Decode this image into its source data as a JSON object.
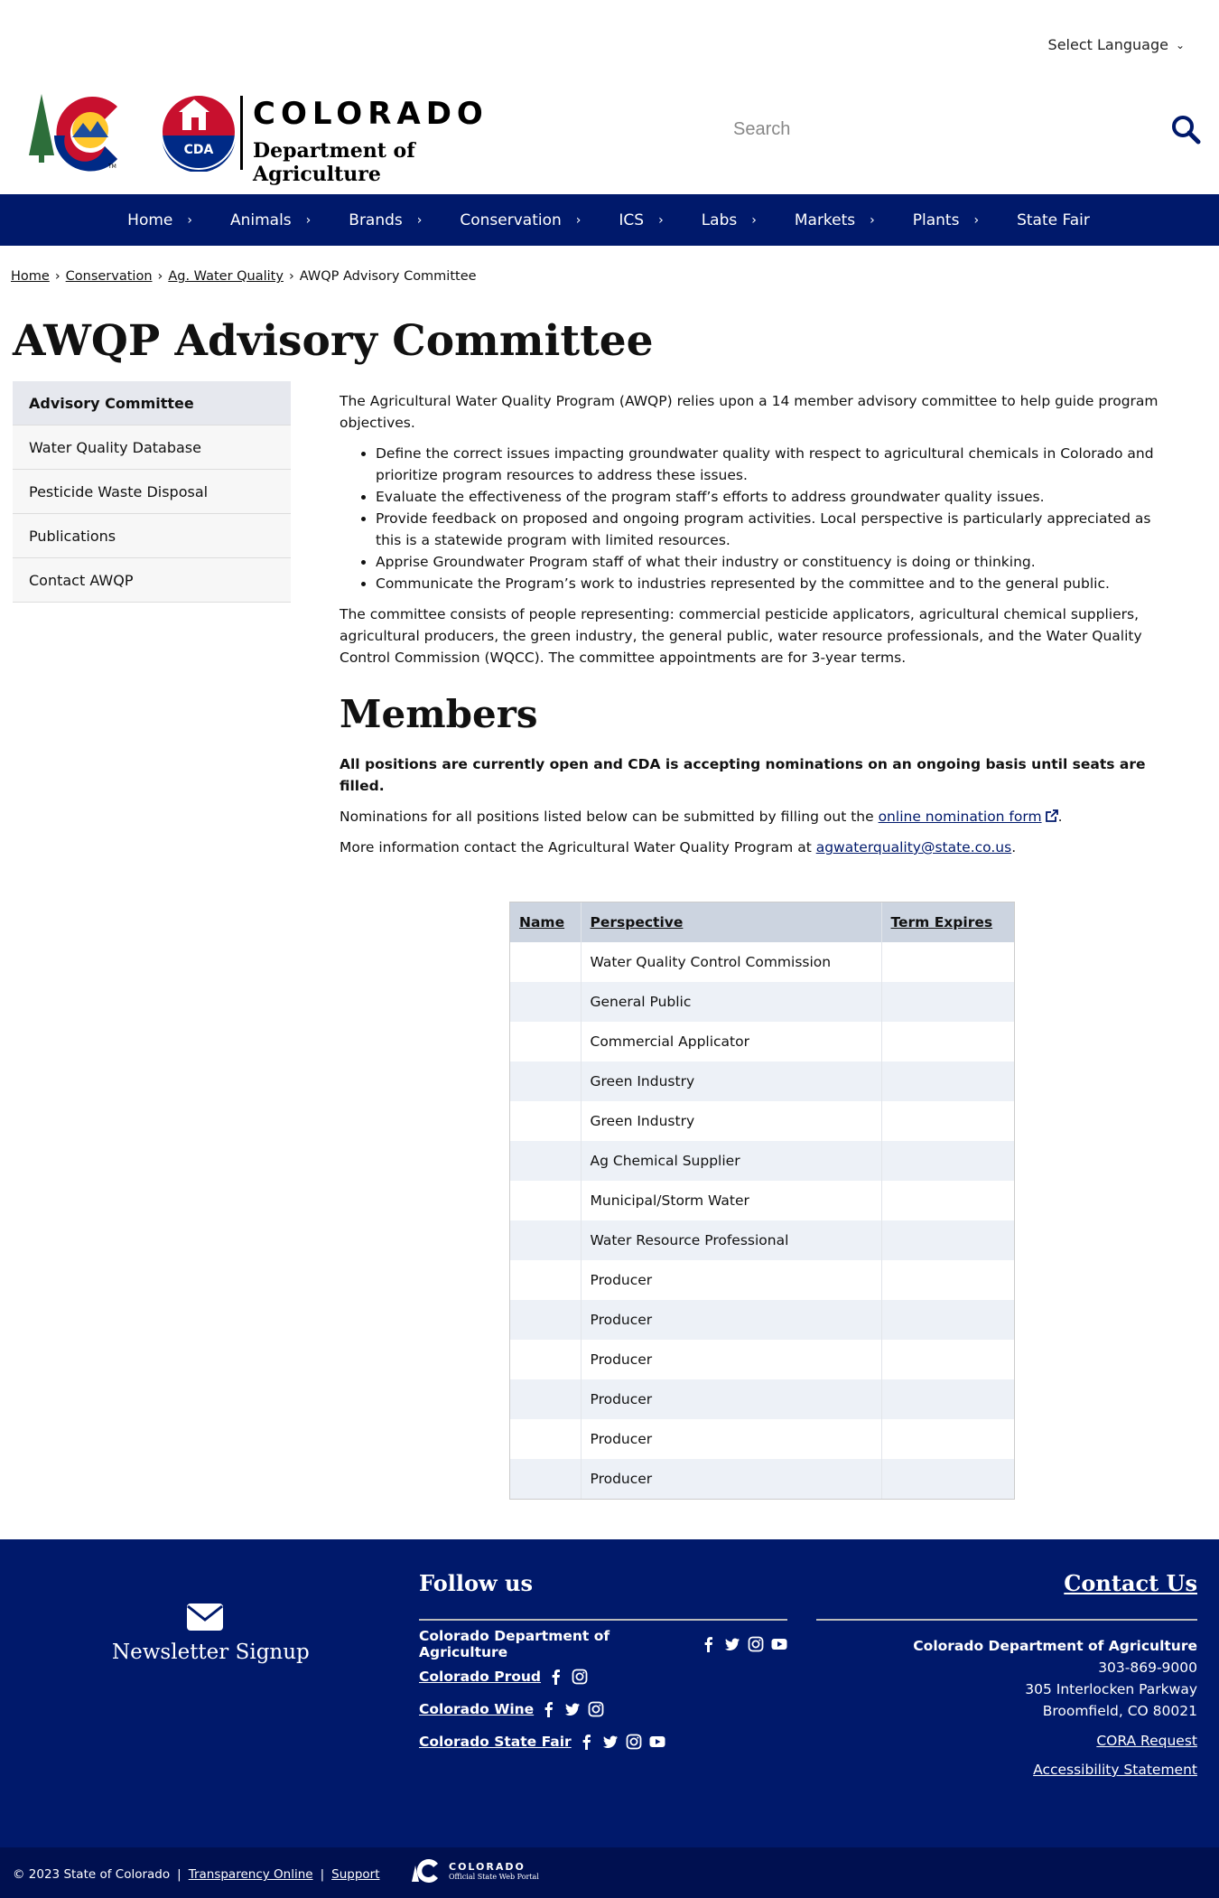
{
  "header": {
    "language_label": "Select Language",
    "logo": {
      "line1": "COLORADO",
      "line2": "Department of Agriculture",
      "badge": "CDA",
      "tm": "TM"
    },
    "search_placeholder": "Search"
  },
  "nav": {
    "items": [
      {
        "label": "Home"
      },
      {
        "label": "Animals"
      },
      {
        "label": "Brands"
      },
      {
        "label": "Conservation"
      },
      {
        "label": "ICS"
      },
      {
        "label": "Labs"
      },
      {
        "label": "Markets"
      },
      {
        "label": "Plants"
      },
      {
        "label": "State Fair"
      }
    ]
  },
  "breadcrumb": {
    "items": [
      "Home",
      "Conservation",
      "Ag. Water Quality"
    ],
    "current": "AWQP Advisory Committee"
  },
  "page_title": "AWQP Advisory Committee",
  "sidebar": {
    "items": [
      "Advisory Committee",
      "Water Quality Database",
      "Pesticide Waste Disposal",
      "Publications",
      "Contact AWQP"
    ]
  },
  "main": {
    "intro": "The Agricultural Water Quality Program (AWQP) relies upon a 14 member advisory committee to help guide program objectives.",
    "bullets": [
      "Define the correct issues impacting groundwater quality with respect to agricultural chemicals in Colorado and prioritize program resources to address these issues.",
      "Evaluate the effectiveness of the program staff’s efforts to address groundwater quality issues.",
      "Provide feedback on proposed and ongoing program activities. Local perspective is particularly appreciated as this is a statewide program with limited resources.",
      "Apprise Groundwater Program staff of what their industry or constituency is doing or thinking.",
      "Communicate the Program’s work to industries represented by the committee and to the general public."
    ],
    "composition": "The committee consists of people representing: commercial pesticide applicators, agricultural chemical suppliers, agricultural producers, the green industry, the general public, water resource professionals, and the Water Quality Control Commission (WQCC). The committee appointments are for 3-year terms.",
    "members_heading": "Members",
    "open_notice": "All positions are currently open and CDA is accepting nominations on an ongoing basis until seats are filled.",
    "nom_text": "Nominations for all positions listed below can be submitted by filling out the ",
    "nom_link": "online nomination form",
    "nom_end": ".",
    "info_text": "More information contact the Agricultural Water Quality Program at ",
    "info_email": "agwaterquality@state.co.us",
    "info_end": "."
  },
  "table": {
    "headers": [
      "Name",
      "Perspective",
      "Term Expires"
    ],
    "rows": [
      {
        "name": "",
        "perspective": "Water Quality Control Commission",
        "term": ""
      },
      {
        "name": "",
        "perspective": "General Public",
        "term": ""
      },
      {
        "name": "",
        "perspective": "Commercial Applicator",
        "term": ""
      },
      {
        "name": "",
        "perspective": "Green Industry",
        "term": ""
      },
      {
        "name": "",
        "perspective": "Green Industry",
        "term": ""
      },
      {
        "name": "",
        "perspective": "Ag Chemical Supplier",
        "term": ""
      },
      {
        "name": "",
        "perspective": "Municipal/Storm Water",
        "term": ""
      },
      {
        "name": "",
        "perspective": "Water Resource Professional",
        "term": ""
      },
      {
        "name": "",
        "perspective": "Producer",
        "term": ""
      },
      {
        "name": "",
        "perspective": "Producer",
        "term": ""
      },
      {
        "name": "",
        "perspective": "Producer",
        "term": ""
      },
      {
        "name": "",
        "perspective": "Producer",
        "term": ""
      },
      {
        "name": "",
        "perspective": "Producer",
        "term": ""
      },
      {
        "name": "",
        "perspective": "Producer",
        "term": ""
      }
    ]
  },
  "footer": {
    "newsletter": "Newsletter Signup",
    "follow_heading": "Follow us",
    "follow_rows": [
      {
        "label": "Colorado Department of Agriculture",
        "icons": [
          "facebook-icon",
          "twitter-icon",
          "instagram-icon",
          "youtube-icon"
        ]
      },
      {
        "label": "Colorado Proud",
        "icons": [
          "facebook-icon",
          "instagram-icon"
        ]
      },
      {
        "label": "Colorado Wine",
        "icons": [
          "facebook-icon",
          "twitter-icon",
          "instagram-icon"
        ]
      },
      {
        "label": "Colorado State Fair",
        "icons": [
          "facebook-icon",
          "twitter-icon",
          "instagram-icon",
          "youtube-icon"
        ]
      }
    ],
    "contact_heading": "Contact Us",
    "org": "Colorado Department of Agriculture",
    "phone": "303-869-9000",
    "street": "305 Interlocken Parkway",
    "city": "Broomfield, CO 80021",
    "cora": "CORA Request",
    "accessibility": "Accessibility Statement"
  },
  "subfooter": {
    "copyright": "© 2023 State of Colorado",
    "transparency": "Transparency Online",
    "support": "Support",
    "portal_line1": "COLORADO",
    "portal_line2": "Official State Web Portal"
  },
  "colors": {
    "navy": "#00196b",
    "navy_dark": "#001050",
    "red": "#c8102e",
    "gold": "#ffc72c",
    "green": "#2d6e3a"
  }
}
